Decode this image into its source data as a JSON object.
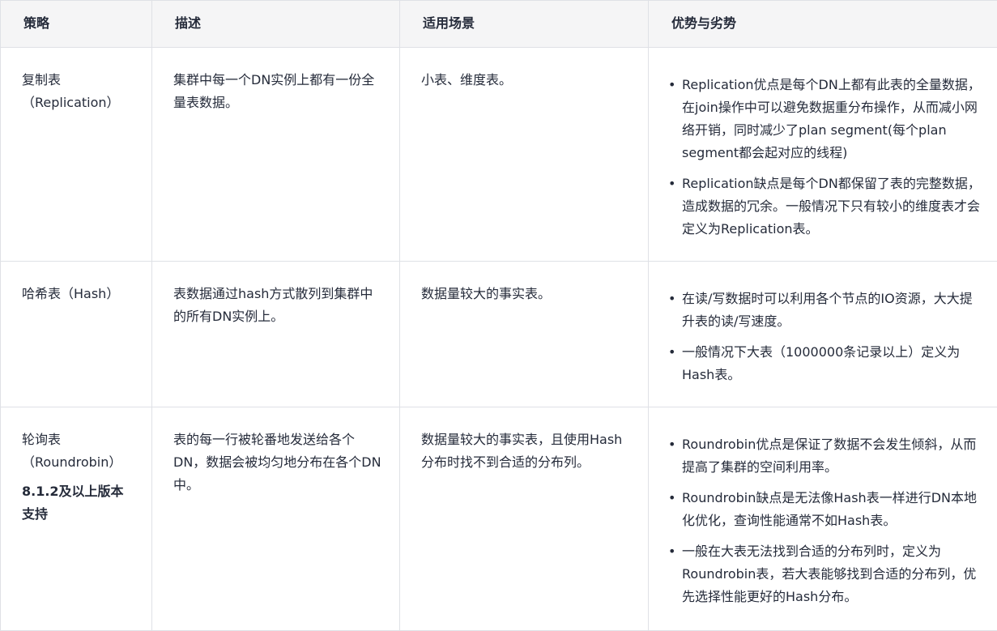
{
  "table": {
    "headers": [
      "策略",
      "描述",
      "适用场景",
      "优势与劣势"
    ],
    "rows": [
      {
        "strategy_lines": [
          "复制表",
          "（Replication）"
        ],
        "strategy_note": "",
        "description": "集群中每一个DN实例上都有一份全量表数据。",
        "scenario": "小表、维度表。",
        "pros_cons": [
          "Replication优点是每个DN上都有此表的全量数据，在join操作中可以避免数据重分布操作，从而减小网络开销，同时减少了plan segment(每个plan segment都会起对应的线程)",
          "Replication缺点是每个DN都保留了表的完整数据，造成数据的冗余。一般情况下只有较小的维度表才会定义为Replication表。"
        ]
      },
      {
        "strategy_lines": [
          "哈希表（Hash）"
        ],
        "strategy_note": "",
        "description": "表数据通过hash方式散列到集群中的所有DN实例上。",
        "scenario": "数据量较大的事实表。",
        "pros_cons": [
          "在读/写数据时可以利用各个节点的IO资源，大大提升表的读/写速度。",
          "一般情况下大表（1000000条记录以上）定义为Hash表。"
        ]
      },
      {
        "strategy_lines": [
          "轮询表",
          "（Roundrobin）"
        ],
        "strategy_note": "8.1.2及以上版本支持",
        "description": "表的每一行被轮番地发送给各个DN，数据会被均匀地分布在各个DN中。",
        "scenario": "数据量较大的事实表，且使用Hash分布时找不到合适的分布列。",
        "pros_cons": [
          "Roundrobin优点是保证了数据不会发生倾斜，从而提高了集群的空间利用率。",
          "Roundrobin缺点是无法像Hash表一样进行DN本地化优化，查询性能通常不如Hash表。",
          "一般在大表无法找到合适的分布列时，定义为Roundrobin表，若大表能够找到合适的分布列，优先选择性能更好的Hash分布。"
        ]
      }
    ]
  }
}
